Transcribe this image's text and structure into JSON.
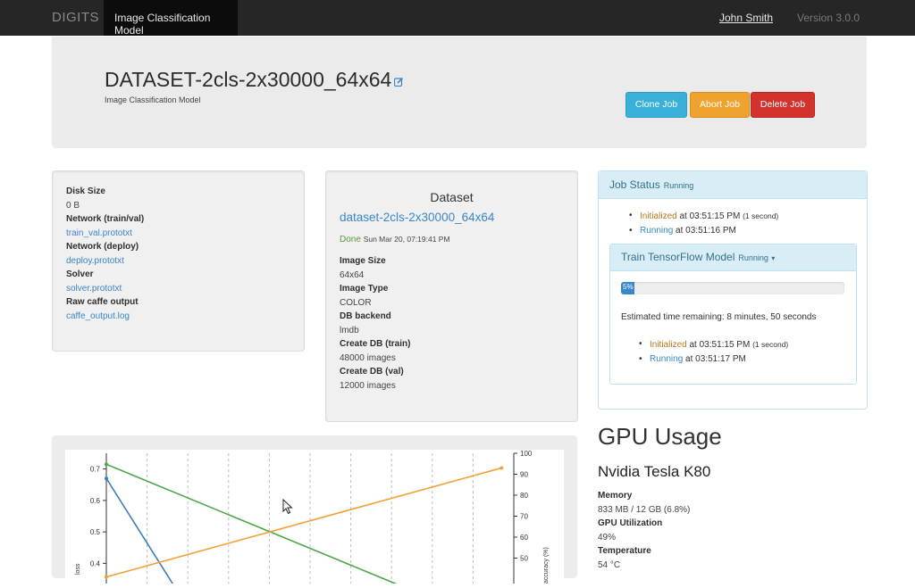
{
  "navbar": {
    "brand": "DIGITS",
    "active_tab": "Image Classification Model",
    "user": "John Smith",
    "version": "Version 3.0.0"
  },
  "header": {
    "title": "DATASET-2cls-2x30000_64x64",
    "subtitle": "Image Classification Model",
    "edit_icon": "edit-icon",
    "buttons": {
      "clone": "Clone Job",
      "abort": "Abort Job",
      "delete": "Delete Job"
    },
    "colors": {
      "clone": "#38b0d9",
      "abort": "#f0a22e",
      "delete": "#d3322d"
    }
  },
  "files": {
    "disk_size_label": "Disk Size",
    "disk_size_value": "0 B",
    "network_train_label": "Network (train/val)",
    "network_train_link": "train_val.prototxt",
    "network_deploy_label": "Network (deploy)",
    "network_deploy_link": "deploy.prototxt",
    "solver_label": "Solver",
    "solver_link": "solver.prototxt",
    "raw_label": "Raw caffe output",
    "raw_link": "caffe_output.log"
  },
  "dataset": {
    "heading": "Dataset",
    "name": "dataset-2cls-2x30000_64x64",
    "status": "Done",
    "status_time": "Sun Mar 20, 07:19:41 PM",
    "image_size_label": "Image Size",
    "image_size_value": "64x64",
    "image_type_label": "Image Type",
    "image_type_value": "COLOR",
    "db_backend_label": "DB backend",
    "db_backend_value": "lmdb",
    "create_train_label": "Create DB (train)",
    "create_train_value": "48000 images",
    "create_val_label": "Create DB (val)",
    "create_val_value": "12000 images"
  },
  "job_status": {
    "title": "Job Status",
    "state": "Running",
    "items": [
      {
        "state": "Initialized",
        "time": "at 03:51:15 PM",
        "extra": "(1 second)"
      },
      {
        "state": "Running",
        "time": "at 03:51:16 PM",
        "extra": ""
      }
    ],
    "train": {
      "title": "Train TensorFlow Model",
      "state": "Running",
      "caret_icon": "caret-down-icon",
      "progress": 5,
      "progress_label": "5%",
      "eta": "Estimated time remaining: 8 minutes, 50 seconds",
      "items": [
        {
          "state": "Initialized",
          "time": "at 03:51:15 PM",
          "extra": "(1 second)"
        },
        {
          "state": "Running",
          "time": "at 03:51:17 PM",
          "extra": ""
        }
      ]
    }
  },
  "gpu": {
    "heading": "GPU Usage",
    "name": "Nvidia Tesla K80",
    "memory_label": "Memory",
    "memory_value": "833 MB / 12 GB (6.8%)",
    "util_label": "GPU Utilization",
    "util_value": "49%",
    "temp_label": "Temperature",
    "temp_value": "54 °C"
  },
  "chart_data": {
    "type": "line",
    "xlim": [
      0,
      1
    ],
    "ylim_left": [
      0.35,
      0.75
    ],
    "ylim_right": [
      40,
      100
    ],
    "left_ticks": [
      "0.7",
      "0.6",
      "0.5",
      "0.4"
    ],
    "left_tick_values": [
      0.7,
      0.6,
      0.5,
      0.4
    ],
    "right_ticks": [
      "100",
      "90",
      "80",
      "70",
      "60",
      "50"
    ],
    "right_tick_values": [
      100,
      90,
      80,
      70,
      60,
      50
    ],
    "ylabel_left": "loss",
    "ylabel_right": "accuracy (%)",
    "grid_x": [
      0.1,
      0.2,
      0.3,
      0.4,
      0.5,
      0.6,
      0.7,
      0.8,
      0.9,
      1.0
    ],
    "series": [
      {
        "axis": "left",
        "color": "#3a7fbf",
        "x": [
          0,
          0.18
        ],
        "y": [
          0.67,
          0.3
        ]
      },
      {
        "axis": "left",
        "color": "#4ea64a",
        "x": [
          0,
          0.72
        ],
        "y": [
          0.715,
          0.33
        ]
      },
      {
        "axis": "right",
        "color": "#efa238",
        "x": [
          0,
          0.97
        ],
        "y": [
          41,
          93
        ]
      }
    ]
  }
}
